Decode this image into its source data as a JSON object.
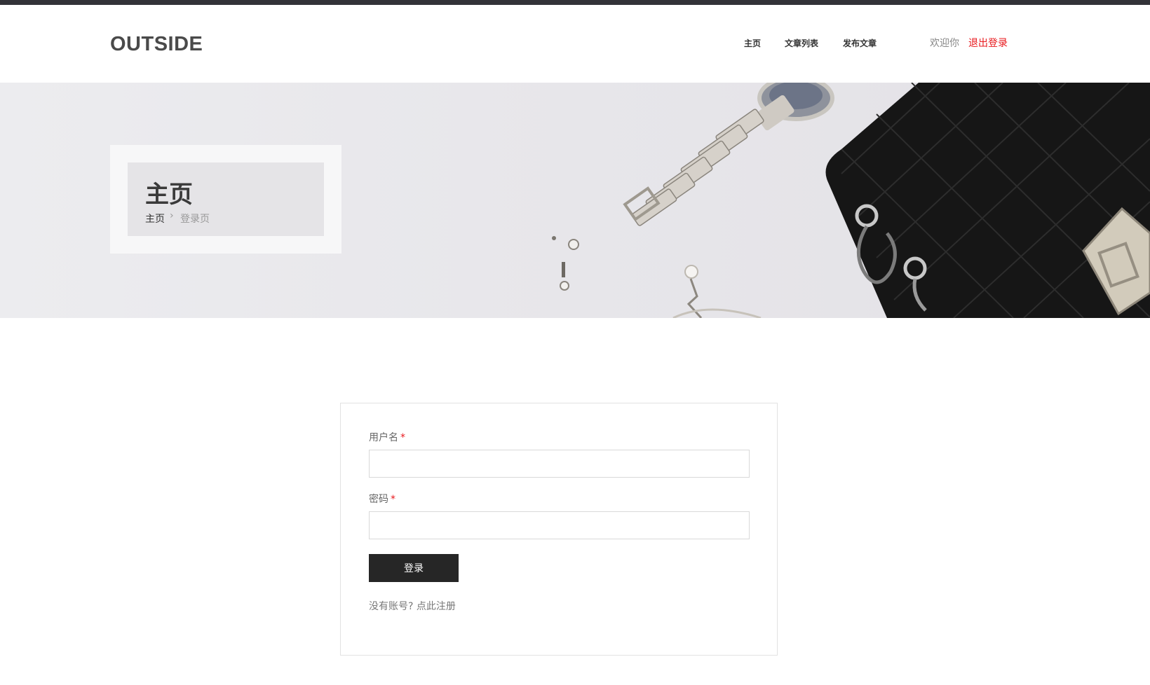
{
  "header": {
    "logo": "OUTSIDE",
    "nav": {
      "home": "主页",
      "article_list": "文章列表",
      "publish": "发布文章"
    },
    "welcome": "欢迎你",
    "logout": "退出登录"
  },
  "banner": {
    "title": "主页",
    "breadcrumb": {
      "home": "主页",
      "separator": "›",
      "current": "登录页"
    }
  },
  "form": {
    "username_label": "用户名",
    "password_label": "密码",
    "required_mark": "*",
    "username_value": "",
    "password_value": "",
    "submit_label": "登录",
    "no_account_text": "没有账号?",
    "register_link": "点此注册"
  },
  "colors": {
    "accent_red": "#e8191d",
    "button_dark": "#262626",
    "logo_gray": "#4a4a4a"
  }
}
